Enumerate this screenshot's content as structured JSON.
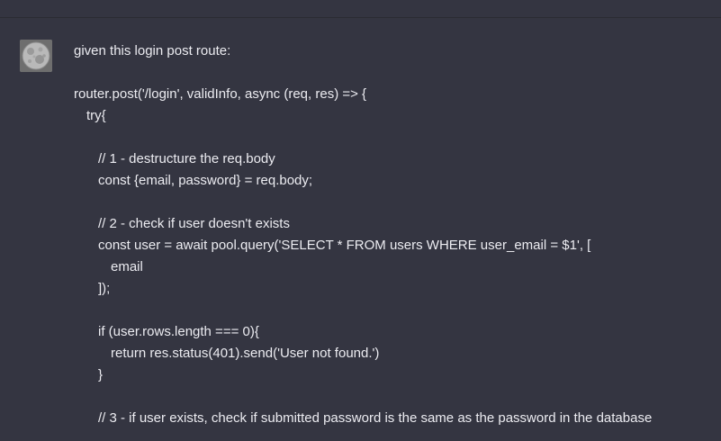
{
  "message": {
    "avatar": "user-avatar-moon-icon",
    "lines": [
      {
        "text": "given this login post route:",
        "indent": 0
      },
      {
        "text": "",
        "indent": 0
      },
      {
        "text": "router.post('/login', validInfo, async (req, res) => {",
        "indent": 0
      },
      {
        "text": "try{",
        "indent": 1
      },
      {
        "text": "",
        "indent": 0
      },
      {
        "text": "// 1 - destructure the req.body",
        "indent": 2
      },
      {
        "text": "const {email, password} = req.body;",
        "indent": 2
      },
      {
        "text": "",
        "indent": 0
      },
      {
        "text": "// 2 - check if user doesn't exists",
        "indent": 2
      },
      {
        "text": "const user = await pool.query('SELECT * FROM users WHERE user_email = $1', [",
        "indent": 2
      },
      {
        "text": "email",
        "indent": 3
      },
      {
        "text": "]);",
        "indent": 2
      },
      {
        "text": "",
        "indent": 0
      },
      {
        "text": "if (user.rows.length === 0){",
        "indent": 2
      },
      {
        "text": "return res.status(401).send('User not found.')",
        "indent": 3
      },
      {
        "text": "}",
        "indent": 2
      },
      {
        "text": "",
        "indent": 0
      },
      {
        "text": "// 3 - if user exists, check if submitted password is the same as the password in the database",
        "indent": 2
      }
    ]
  },
  "colors": {
    "background": "#343541",
    "text": "#ececf1"
  }
}
